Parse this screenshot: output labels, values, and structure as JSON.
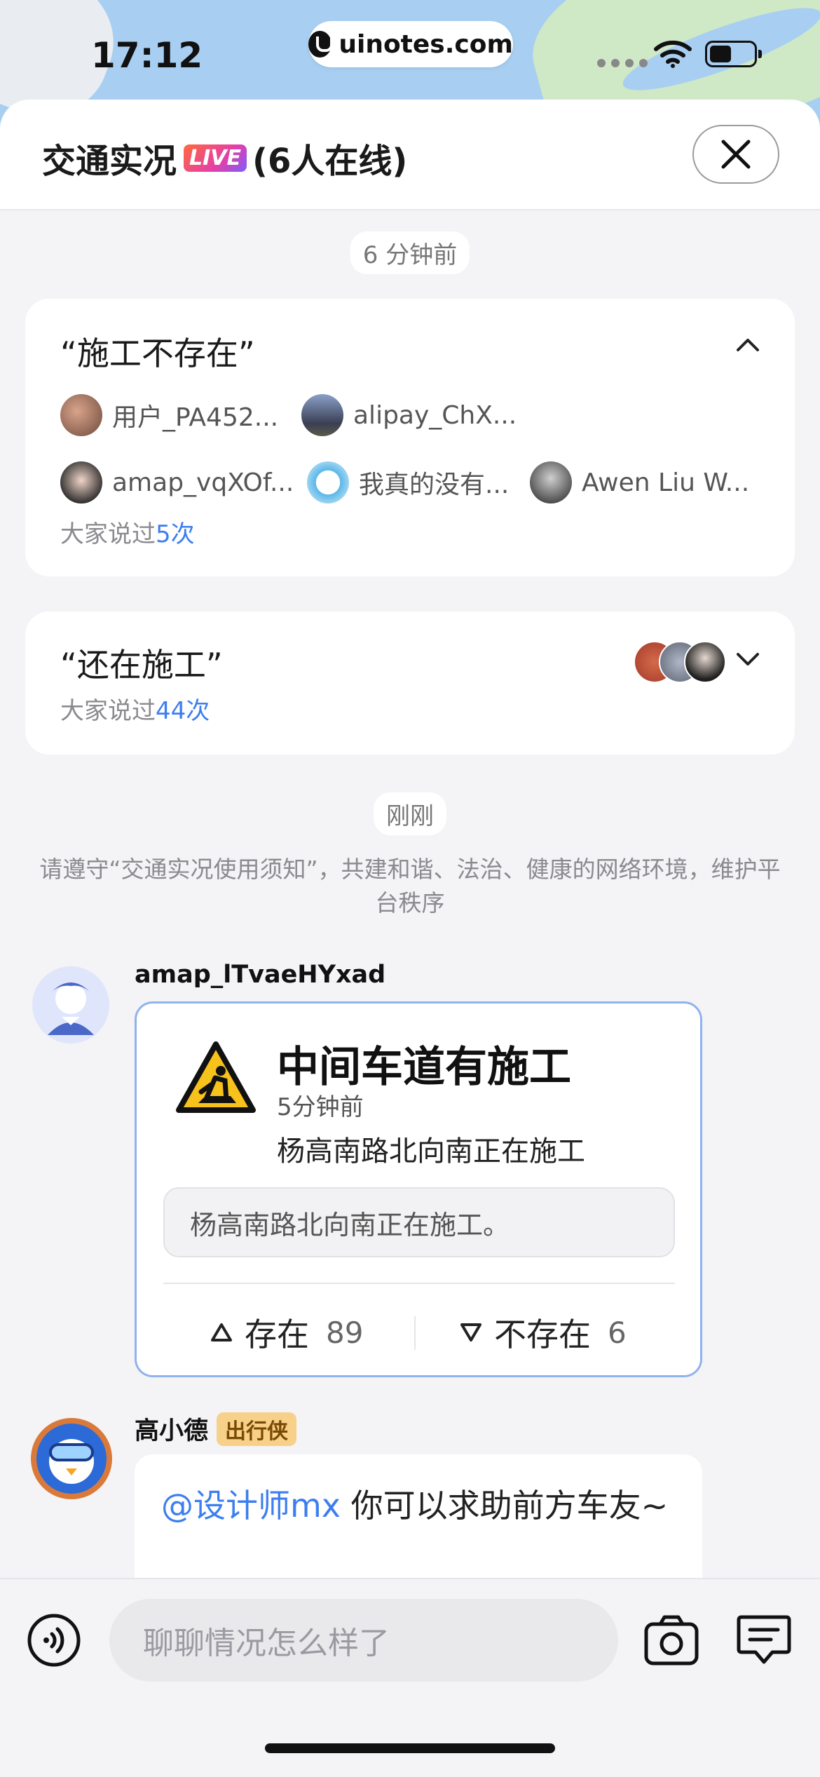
{
  "status_bar": {
    "time": "17:12",
    "url": "uinotes.com"
  },
  "header": {
    "title_prefix": "交通实况",
    "live_badge": "LIVE",
    "title_suffix": "(6人在线)"
  },
  "feed": {
    "time_label_1": "6 分钟前",
    "topic_1": {
      "quote": "“施工不存在”",
      "users": [
        "用户_PA452...",
        "alipay_ChX...",
        "amap_vqXOf...",
        "我真的没有...",
        "Awen Liu W..."
      ],
      "said_prefix": "大家说过",
      "said_count": "5次"
    },
    "topic_2": {
      "quote": "“还在施工”",
      "said_prefix": "大家说过",
      "said_count": "44次"
    },
    "time_label_2": "刚刚",
    "notice": "请遵守“交通实况使用须知”，共建和谐、法治、健康的网络环境，维护平台秩序",
    "message_1": {
      "sender": "amap_lTvaeHYxad",
      "report_title": "中间车道有施工",
      "report_time": "5分钟前",
      "report_desc": "杨高南路北向南正在施工",
      "report_quote": "杨高南路北向南正在施工。",
      "vote_yes_label": "存在",
      "vote_yes_count": "89",
      "vote_no_label": "不存在",
      "vote_no_count": "6"
    },
    "message_2": {
      "sender": "高小德",
      "sender_badge": "出行侠",
      "mention": "@设计师mx",
      "text": " 你可以求助前方车友~"
    }
  },
  "composer": {
    "placeholder": "聊聊情况怎么样了"
  },
  "icons": [
    "voice-icon",
    "camera-icon",
    "chat-list-icon",
    "close-icon",
    "chevron-up-icon",
    "chevron-down-icon",
    "construction-warning-icon",
    "thumb-up-triangle-icon",
    "thumb-down-triangle-icon",
    "wifi-icon",
    "battery-icon"
  ],
  "colors": {
    "accent_blue": "#3c7ef0",
    "card_border": "#8fb3ec",
    "badge_bg": "#f7d08a"
  }
}
